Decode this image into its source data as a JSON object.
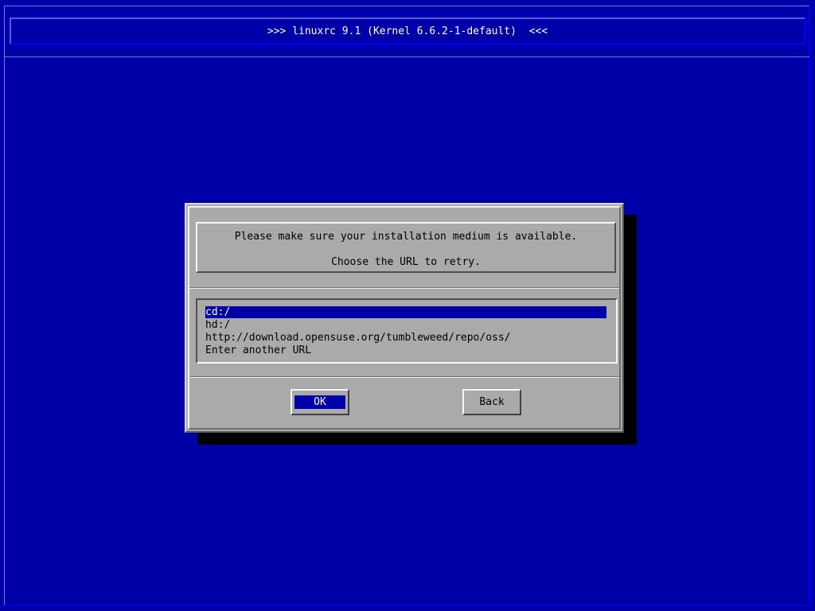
{
  "window": {
    "title": ">>> linuxrc 9.1 (Kernel 6.6.2-1-default)  <<<"
  },
  "dialog": {
    "message_line1": "Please make sure your installation medium is available.",
    "message_line2": "Choose the URL to retry.",
    "options": [
      {
        "label": "cd:/",
        "selected": true
      },
      {
        "label": "hd:/",
        "selected": false
      },
      {
        "label": "http://download.opensuse.org/tumbleweed/repo/oss/",
        "selected": false
      },
      {
        "label": "Enter another URL",
        "selected": false
      }
    ],
    "ok_label": "OK",
    "back_label": "Back"
  },
  "colors": {
    "background": "#0000a8",
    "dialog": "#aaaaaa",
    "highlight": "#0000a8",
    "text": "#000000",
    "highlight_text": "#ffffff"
  }
}
